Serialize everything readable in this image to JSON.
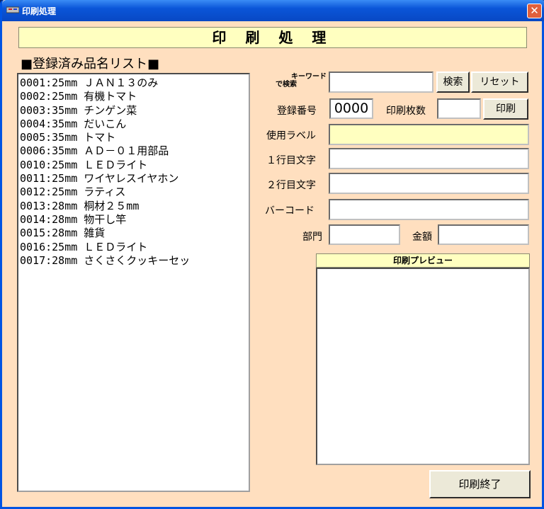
{
  "window": {
    "title": "印刷処理",
    "close_symbol": "✕"
  },
  "header": {
    "title": "印 刷 処 理"
  },
  "list": {
    "title": "■登録済み品名リスト■",
    "items": [
      "0001:25mm ＪＡＮ１３のみ",
      "0002:25mm 有機トマト",
      "0003:35mm チンゲン菜",
      "0004:35mm だいこん",
      "0005:35mm トマト",
      "0006:35mm ＡＤ－０１用部品",
      "0010:25mm ＬＥＤライト",
      "0011:25mm ワイヤレスイヤホン",
      "0012:25mm ラティス",
      "0013:28mm 桐材２５mm",
      "0014:28mm 物干し竿",
      "0015:28mm 雑貨",
      "0016:25mm ＬＥＤライト",
      "0017:28mm さくさくクッキーセッ"
    ]
  },
  "form": {
    "keyword_label_1": "キーワード",
    "keyword_label_2": "で検索",
    "search_button": "検索",
    "reset_button": "リセット",
    "regnum_label": "登録番号",
    "regnum_value": "0000",
    "copies_label": "印刷枚数",
    "print_button": "印刷",
    "label_used": "使用ラベル",
    "line1_label": "１行目文字",
    "line2_label": "２行目文字",
    "barcode_label": "バーコード",
    "dept_label": "部門",
    "amount_label": "金額"
  },
  "preview": {
    "title": "印刷プレビュー"
  },
  "footer": {
    "exit_button": "印刷終了"
  }
}
